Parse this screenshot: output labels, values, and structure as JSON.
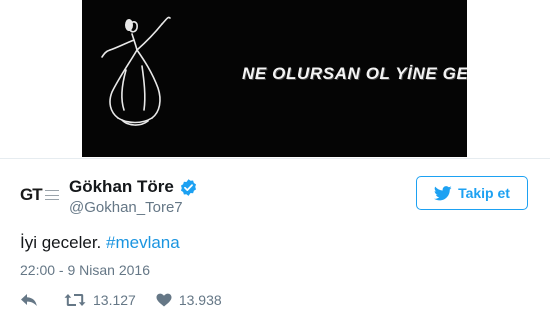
{
  "media": {
    "caption": "NE OLURSAN OL YİNE GEL..."
  },
  "author": {
    "avatar_icon": "gt-logo-icon",
    "avatar_text": "GT",
    "name": "Gökhan Töre",
    "handle": "@Gokhan_Tore7",
    "verified": true
  },
  "follow_button": {
    "label": "Takip et",
    "icon": "twitter-bird-icon",
    "color": "#1da1f2"
  },
  "tweet": {
    "text": "İyi geceler.",
    "hashtag": "#mevlana",
    "timestamp": "22:00 - 9 Nisan 2016"
  },
  "actions": {
    "reply_icon": "reply-icon",
    "retweet_icon": "retweet-icon",
    "retweet_count": "13.127",
    "like_icon": "heart-icon",
    "like_count": "13.938"
  },
  "colors": {
    "accent": "#1da1f2",
    "hashtag": "#1b95e0",
    "secondary_text": "#657786",
    "primary_text": "#14171a",
    "media_bg": "#050505"
  }
}
